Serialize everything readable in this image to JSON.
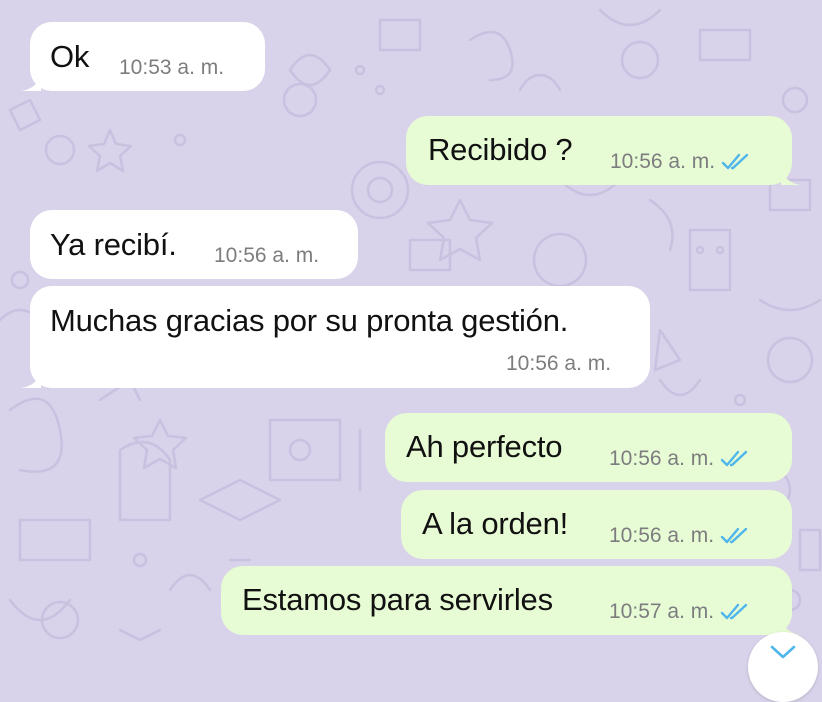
{
  "colors": {
    "background": "#d8d2ea",
    "incoming_bubble": "#ffffff",
    "outgoing_bubble": "#e7fbd4",
    "read_ticks": "#4fb6ec",
    "timestamp": "#7d7d80"
  },
  "messages": [
    {
      "direction": "incoming",
      "text": "Ok",
      "time": "10:53 a. m."
    },
    {
      "direction": "outgoing",
      "text": "Recibido ?",
      "time": "10:56 a. m.",
      "status_icon": "double-check-read-icon"
    },
    {
      "direction": "incoming",
      "text": "Ya recibí.",
      "time": "10:56 a. m."
    },
    {
      "direction": "incoming",
      "text": "Muchas gracias por su pronta gestión.",
      "time": "10:56 a. m."
    },
    {
      "direction": "outgoing",
      "text": "Ah perfecto",
      "time": "10:56 a. m.",
      "status_icon": "double-check-read-icon"
    },
    {
      "direction": "outgoing",
      "text": "A la orden!",
      "time": "10:56 a. m.",
      "status_icon": "double-check-read-icon"
    },
    {
      "direction": "outgoing",
      "text": "Estamos para servirles",
      "time": "10:57 a. m.",
      "status_icon": "double-check-read-icon"
    }
  ],
  "scroll_button_icon": "chevron-down-icon"
}
